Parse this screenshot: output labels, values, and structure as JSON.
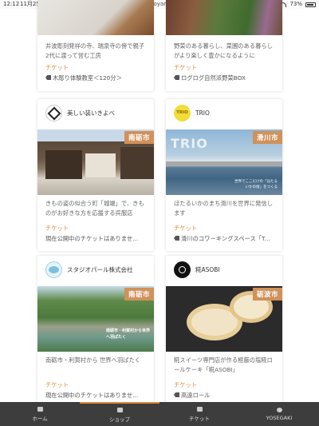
{
  "status": {
    "time": "12:12",
    "date": "11月25日(日)",
    "url": "yell-toyama.jp",
    "battery": "73%"
  },
  "cards": [
    {
      "desc": "井波彫刻発祥の寺、瑞泉寺の傍で親子2代に渡って営む工房",
      "ticket_label": "チケット",
      "ticket": "木彫り体験教室＜120分＞"
    },
    {
      "desc": "野菜のある暮らし、菜園のある暮らしがより楽しく豊かになるように",
      "ticket_label": "チケット",
      "ticket": "ログログ自然派野菜BOX"
    },
    {
      "shop": "美しい装いきよべ",
      "badge": "南砺市",
      "desc": "きもの姿の似合う町「城端」で、きものがお好きな方を応援する呉服店",
      "ticket_label": "チケット",
      "ticket": "現在公開中のチケットはありませ..."
    },
    {
      "shop": "TRIO",
      "badge": "滑川市",
      "desc": "ほたるいかのまち滑川を世界に発信します",
      "ticket_label": "チケット",
      "ticket": "滑川のコワーキングスペース「T...",
      "photo_text": "TRIO",
      "photo_sub": "世界でここだけの「ほたるいかの街」をつくる",
      "logo_text": "TRIO"
    },
    {
      "shop": "スタジオパール株式会社",
      "badge": "南砺市",
      "desc": "南砺市・利賀村から 世界へ羽ばたく",
      "ticket_label": "チケット",
      "ticket": "現在公開中のチケットはありませ...",
      "photo_text": "南砺市・利賀村から世界へ羽ばたく"
    },
    {
      "shop": "糀ASOBI",
      "badge": "砺波市",
      "desc": "糀スイーツ専門店が作る極厳の塩糀ロールケーキ「糀ASOBI」",
      "ticket_label": "チケット",
      "ticket": "高遠ロール"
    }
  ],
  "tabs": [
    {
      "label": "ホーム"
    },
    {
      "label": "ショップ"
    },
    {
      "label": "チケット"
    },
    {
      "label": "YOSEGAKI"
    }
  ]
}
